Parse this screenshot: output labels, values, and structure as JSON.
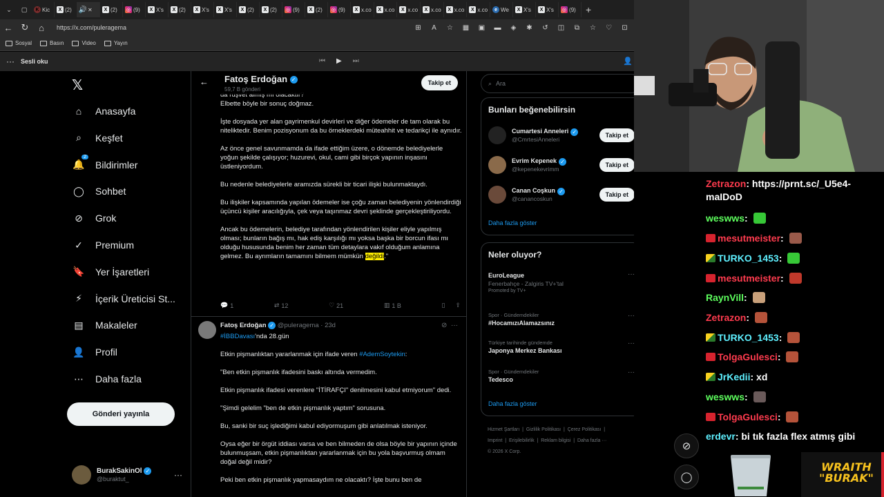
{
  "browser": {
    "tabs": [
      {
        "fav": "K",
        "favclass": "kick",
        "label": "Kic"
      },
      {
        "fav": "X",
        "favclass": "",
        "label": "(2)"
      },
      {
        "fav": "🔊",
        "favclass": "spk",
        "label": "✕",
        "active": true
      },
      {
        "fav": "X",
        "favclass": "",
        "label": "(2)"
      },
      {
        "fav": "◎",
        "favclass": "ig",
        "label": "(9)"
      },
      {
        "fav": "X",
        "favclass": "",
        "label": "X's"
      },
      {
        "fav": "X",
        "favclass": "",
        "label": "(2)"
      },
      {
        "fav": "X",
        "favclass": "",
        "label": "X's"
      },
      {
        "fav": "X",
        "favclass": "",
        "label": "X's"
      },
      {
        "fav": "X",
        "favclass": "",
        "label": "(2)"
      },
      {
        "fav": "X",
        "favclass": "",
        "label": "(2)"
      },
      {
        "fav": "◎",
        "favclass": "ig",
        "label": "(9)"
      },
      {
        "fav": "X",
        "favclass": "",
        "label": "(2)"
      },
      {
        "fav": "◎",
        "favclass": "ig",
        "label": "(9)"
      },
      {
        "fav": "X",
        "favclass": "",
        "label": "x.co"
      },
      {
        "fav": "X",
        "favclass": "",
        "label": "x.co"
      },
      {
        "fav": "X",
        "favclass": "",
        "label": "x.co"
      },
      {
        "fav": "X",
        "favclass": "",
        "label": "x.co"
      },
      {
        "fav": "X",
        "favclass": "",
        "label": "x.co"
      },
      {
        "fav": "X",
        "favclass": "",
        "label": "x.co"
      },
      {
        "fav": "e",
        "favclass": "edge",
        "label": "We"
      },
      {
        "fav": "X",
        "favclass": "",
        "label": "X's"
      },
      {
        "fav": "X",
        "favclass": "",
        "label": "X's"
      },
      {
        "fav": "◎",
        "favclass": "ig",
        "label": "(9)"
      }
    ],
    "url": "https://x.com/puleragema",
    "bookmarks": [
      "Sosyal",
      "Basın",
      "Video",
      "Yayın"
    ],
    "read_aloud": "Sesli oku"
  },
  "nav": {
    "items": [
      {
        "icon": "⌂",
        "label": "Anasayfa",
        "name": "home"
      },
      {
        "icon": "⌕",
        "label": "Keşfet",
        "name": "explore"
      },
      {
        "icon": "🔔",
        "label": "Bildirimler",
        "name": "notifications",
        "badge": "2"
      },
      {
        "icon": "◯",
        "label": "Sohbet",
        "name": "chat"
      },
      {
        "icon": "⊘",
        "label": "Grok",
        "name": "grok"
      },
      {
        "icon": "✓",
        "label": "Premium",
        "name": "premium"
      },
      {
        "icon": "🔖",
        "label": "Yer İşaretleri",
        "name": "bookmarks"
      },
      {
        "icon": "⚡",
        "label": "İçerik Üreticisi St...",
        "name": "creator-studio"
      },
      {
        "icon": "▤",
        "label": "Makaleler",
        "name": "articles"
      },
      {
        "icon": "👤",
        "label": "Profil",
        "name": "profile"
      },
      {
        "icon": "⋯",
        "label": "Daha fazla",
        "name": "more"
      }
    ],
    "post_button": "Gönderi yayınla",
    "account": {
      "name": "BurakSakinOl",
      "handle": "@buraktut_"
    }
  },
  "profile_header": {
    "name": "Fatoş Erdoğan",
    "post_count": "59,7 B gönderi",
    "follow": "Takip et"
  },
  "tweet1": {
    "cut_line": "da rüşvet almış mı olacaktır?",
    "p0": "Elbette böyle bir sonuç doğmaz.",
    "p1": "İşte dosyada yer alan gayrimenkul devirleri ve diğer ödemeler de tam olarak bu niteliktedir. Benim pozisyonum da bu örneklerdeki müteahhit ve tedarikçi ile aynıdır.",
    "p2": "Az önce genel savunmamda da ifade ettiğim üzere, o dönemde belediyelerle yoğun şekilde çalışıyor; huzurevi, okul, cami gibi birçok yapının inşasını üstleniyordum.",
    "p3": "Bu nedenle belediyelerle aramızda sürekli bir ticari ilişki bulunmaktaydı.",
    "p4": "Bu ilişkiler kapsamında yapılan ödemeler ise çoğu zaman belediyenin yönlendirdiği üçüncü kişiler aracılığıyla, çek veya taşınmaz devri şeklinde gerçekleştiriliyordu.",
    "p5": "Ancak bu ödemelerin, belediye tarafından yönlendirilen kişiler eliyle yapılmış olması; bunların bağış mı, hak ediş karşılığı mı yoksa başka bir borcun ifası mı olduğu hususunda benim her zaman tüm detaylara vakıf olduğum anlamına gelmez. Bu ayrımların tamamını bilmem mümkün",
    "p5_hl": "değildi",
    "p5_end": ".\"",
    "replies": "1",
    "reposts": "12",
    "likes": "21",
    "views": "1 B"
  },
  "tweet2": {
    "name": "Fatoş Erdoğan",
    "handle": "@puleragema",
    "time": "23d",
    "hashtag": "#İBBDavası",
    "hashtag_rest": "'nda 28.gün",
    "p1a": "Etkin pişmanlıktan yararlanmak için ifade veren ",
    "p1_link": "#AdemSoytekin",
    "p1b": ":",
    "p2": "\"Ben etkin pişmanlık ifadesini baskı altında vermedim.",
    "p3": "Etkin pişmanlık ifadesi verenlere \"İTİRAFÇI\" denilmesini kabul etmiyorum\" dedi.",
    "p4": "\"Şimdi gelelim \"ben de etkin pişmanlık yaptım\" sorusuna.",
    "p5": "Bu, sanki bir suç işlediğimi kabul ediyormuşum gibi anlatılmak isteniyor.",
    "p6": "Oysa eğer bir örgüt iddiası varsa ve ben bilmeden de olsa böyle bir yapının içinde bulunmuşsam, etkin pişmanlıktan yararlanmak için bu yola başvurmuş olmam doğal değil midir?",
    "p7": "Peki ben etkin pişmanlık yapmasaydım ne olacaktı? İşte bunu ben de"
  },
  "right": {
    "search_placeholder": "Ara",
    "suggest_title": "Bunları beğenebilirsin",
    "suggestions": [
      {
        "name": "Cumartesi Anneleri",
        "handle": "@CmrtesiAnneleri",
        "btn": "Takip et",
        "color": "#222"
      },
      {
        "name": "Evrim Kepenek",
        "handle": "@kepenekevrimm",
        "btn": "Takip et",
        "color": "#8a6a4a"
      },
      {
        "name": "Canan Coşkun",
        "handle": "@canancoskun",
        "btn": "Takip et",
        "color": "#6a4a3a"
      }
    ],
    "show_more": "Daha fazla göster",
    "trends_title": "Neler oluyor?",
    "trends": [
      {
        "meta": "",
        "name": "EuroLeague",
        "sub": "Fenerbahçe - Zalgiris TV+'tal",
        "promo": "Promoted by TV+"
      },
      {
        "meta": "Spor · Gündemdekiler",
        "name": "#HocamızıAlamazsınız",
        "sub": "",
        "promo": ""
      },
      {
        "meta": "Türkiye tarihinde gündemde",
        "name": "Japonya Merkez Bankası",
        "sub": "",
        "promo": ""
      },
      {
        "meta": "Spor · Gündemdekiler",
        "name": "Tedesco",
        "sub": "",
        "promo": ""
      }
    ],
    "trends_more": "Daha fazla göster",
    "footer": [
      "Hizmet Şartları",
      "Gizlilik Politikası",
      "Çerez Politikası",
      "Imprint",
      "Erişilebilirlik",
      "Reklam bilgisi",
      "Daha fazla ···",
      "© 2026 X Corp."
    ]
  },
  "chat": {
    "messages": [
      {
        "user": "Zetrazon",
        "color": "user-red",
        "badge": "",
        "text": "https://prnt.sc/_U5e4-maIDoD",
        "emote": ""
      },
      {
        "user": "weswws",
        "color": "user-green",
        "badge": "",
        "text": "",
        "emote": "#37c837"
      },
      {
        "user": "mesutmeister",
        "color": "user-red",
        "badge": "b-red",
        "text": "",
        "emote": "#9a5a4a"
      },
      {
        "user": "TURKO_1453",
        "color": "user-cyan",
        "badge": "b-yel",
        "text": "",
        "emote": "#37c837"
      },
      {
        "user": "mesutmeister",
        "color": "user-red",
        "badge": "b-red",
        "text": "",
        "emote": "#c0392b"
      },
      {
        "user": "RaynVill",
        "color": "user-green",
        "badge": "",
        "text": "",
        "emote": "#c8a07a"
      },
      {
        "user": "Zetrazon",
        "color": "user-red",
        "badge": "",
        "text": "",
        "emote": "#b5533a"
      },
      {
        "user": "TURKO_1453",
        "color": "user-cyan",
        "badge": "b-yel",
        "text": "",
        "emote": "#b5533a"
      },
      {
        "user": "TolgaGulesci",
        "color": "user-red",
        "badge": "b-red",
        "text": "",
        "emote": "#b5533a"
      },
      {
        "user": "JrKedii",
        "color": "user-cyan",
        "badge": "b-yel",
        "text": "xd",
        "emote": ""
      },
      {
        "user": "weswws",
        "color": "user-green",
        "badge": "",
        "text": "",
        "emote": "#6a5a5a"
      },
      {
        "user": "TolgaGulesci",
        "color": "user-red",
        "badge": "b-red",
        "text": "",
        "emote": "#b5533a"
      },
      {
        "user": "erdevr",
        "color": "user-cyan",
        "badge": "",
        "text": "bi tık fazla flex atmış gibi",
        "emote": ""
      }
    ]
  },
  "overlay": {
    "brand_line1": "WRAITH",
    "brand_line2": "\"BURAK\""
  }
}
